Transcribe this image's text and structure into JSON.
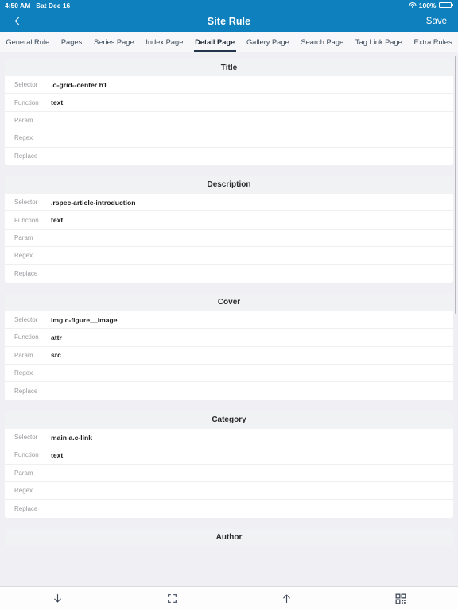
{
  "statusbar": {
    "time": "4:50 AM",
    "date": "Sat Dec 16",
    "wifi_icon": "wifi-icon",
    "battery_percent": "100%",
    "battery_icon": "battery-icon"
  },
  "navbar": {
    "back_icon": "chevron-left-icon",
    "title": "Site Rule",
    "save_label": "Save",
    "background_color": "#0e80bd"
  },
  "tabs": [
    {
      "label": "General Rule",
      "active": false
    },
    {
      "label": "Pages",
      "active": false
    },
    {
      "label": "Series Page",
      "active": false
    },
    {
      "label": "Index Page",
      "active": false
    },
    {
      "label": "Detail Page",
      "active": true
    },
    {
      "label": "Gallery Page",
      "active": false
    },
    {
      "label": "Search Page",
      "active": false
    },
    {
      "label": "Tag Link Page",
      "active": false
    },
    {
      "label": "Extra Rules",
      "active": false
    }
  ],
  "row_labels": [
    "Selector",
    "Function",
    "Param",
    "Regex",
    "Replace"
  ],
  "cards": [
    {
      "title": "Title",
      "rows": [
        {
          "label": "Selector",
          "value": ".o-grid--center h1"
        },
        {
          "label": "Function",
          "value": "text"
        },
        {
          "label": "Param",
          "value": ""
        },
        {
          "label": "Regex",
          "value": ""
        },
        {
          "label": "Replace",
          "value": ""
        }
      ]
    },
    {
      "title": "Description",
      "rows": [
        {
          "label": "Selector",
          "value": ".rspec-article-introduction"
        },
        {
          "label": "Function",
          "value": "text"
        },
        {
          "label": "Param",
          "value": ""
        },
        {
          "label": "Regex",
          "value": ""
        },
        {
          "label": "Replace",
          "value": ""
        }
      ]
    },
    {
      "title": "Cover",
      "rows": [
        {
          "label": "Selector",
          "value": "img.c-figure__image"
        },
        {
          "label": "Function",
          "value": "attr"
        },
        {
          "label": "Param",
          "value": "src"
        },
        {
          "label": "Regex",
          "value": ""
        },
        {
          "label": "Replace",
          "value": ""
        }
      ]
    },
    {
      "title": "Category",
      "rows": [
        {
          "label": "Selector",
          "value": "main a.c-link"
        },
        {
          "label": "Function",
          "value": "text"
        },
        {
          "label": "Param",
          "value": ""
        },
        {
          "label": "Regex",
          "value": ""
        },
        {
          "label": "Replace",
          "value": ""
        }
      ]
    },
    {
      "title": "Author",
      "rows": []
    }
  ],
  "toolbar": [
    {
      "icon": "arrow-down-icon"
    },
    {
      "icon": "scan-frame-icon"
    },
    {
      "icon": "arrow-up-icon"
    },
    {
      "icon": "qr-code-icon"
    }
  ]
}
